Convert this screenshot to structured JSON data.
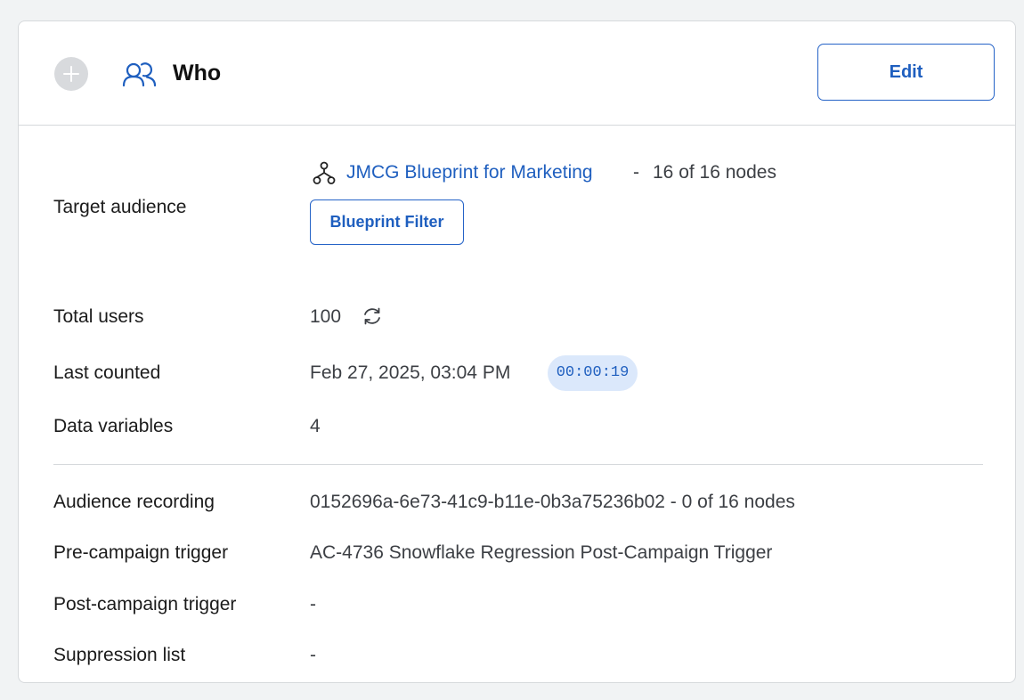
{
  "header": {
    "title": "Who",
    "edit_label": "Edit",
    "add_icon": "plus-circle-icon",
    "section_icon": "users-icon"
  },
  "target_audience": {
    "label": "Target audience",
    "blueprint_icon": "hierarchy-icon",
    "blueprint_name": "JMCG Blueprint for Marketing",
    "separator": "-",
    "nodes": "16 of 16 nodes",
    "filter_label": "Blueprint Filter"
  },
  "total_users": {
    "label": "Total users",
    "value": "100",
    "refresh_icon": "refresh-icon"
  },
  "last_counted": {
    "label": "Last counted",
    "value": "Feb 27, 2025, 03:04 PM",
    "elapsed": "00:00:19"
  },
  "data_variables": {
    "label": "Data variables",
    "value": "4"
  },
  "audience_recording": {
    "label": "Audience recording",
    "value": "0152696a-6e73-41c9-b11e-0b3a75236b02 - 0 of 16 nodes"
  },
  "pre_campaign_trigger": {
    "label": "Pre-campaign trigger",
    "value": "AC-4736 Snowflake Regression Post-Campaign Trigger"
  },
  "post_campaign_trigger": {
    "label": "Post-campaign trigger",
    "value": "-"
  },
  "suppression_list": {
    "label": "Suppression list",
    "value": "-"
  },
  "colors": {
    "accent": "#1f5fbf",
    "badge_bg": "#dbe8fb",
    "border": "#d6d9dc",
    "page_bg": "#f1f3f4"
  }
}
